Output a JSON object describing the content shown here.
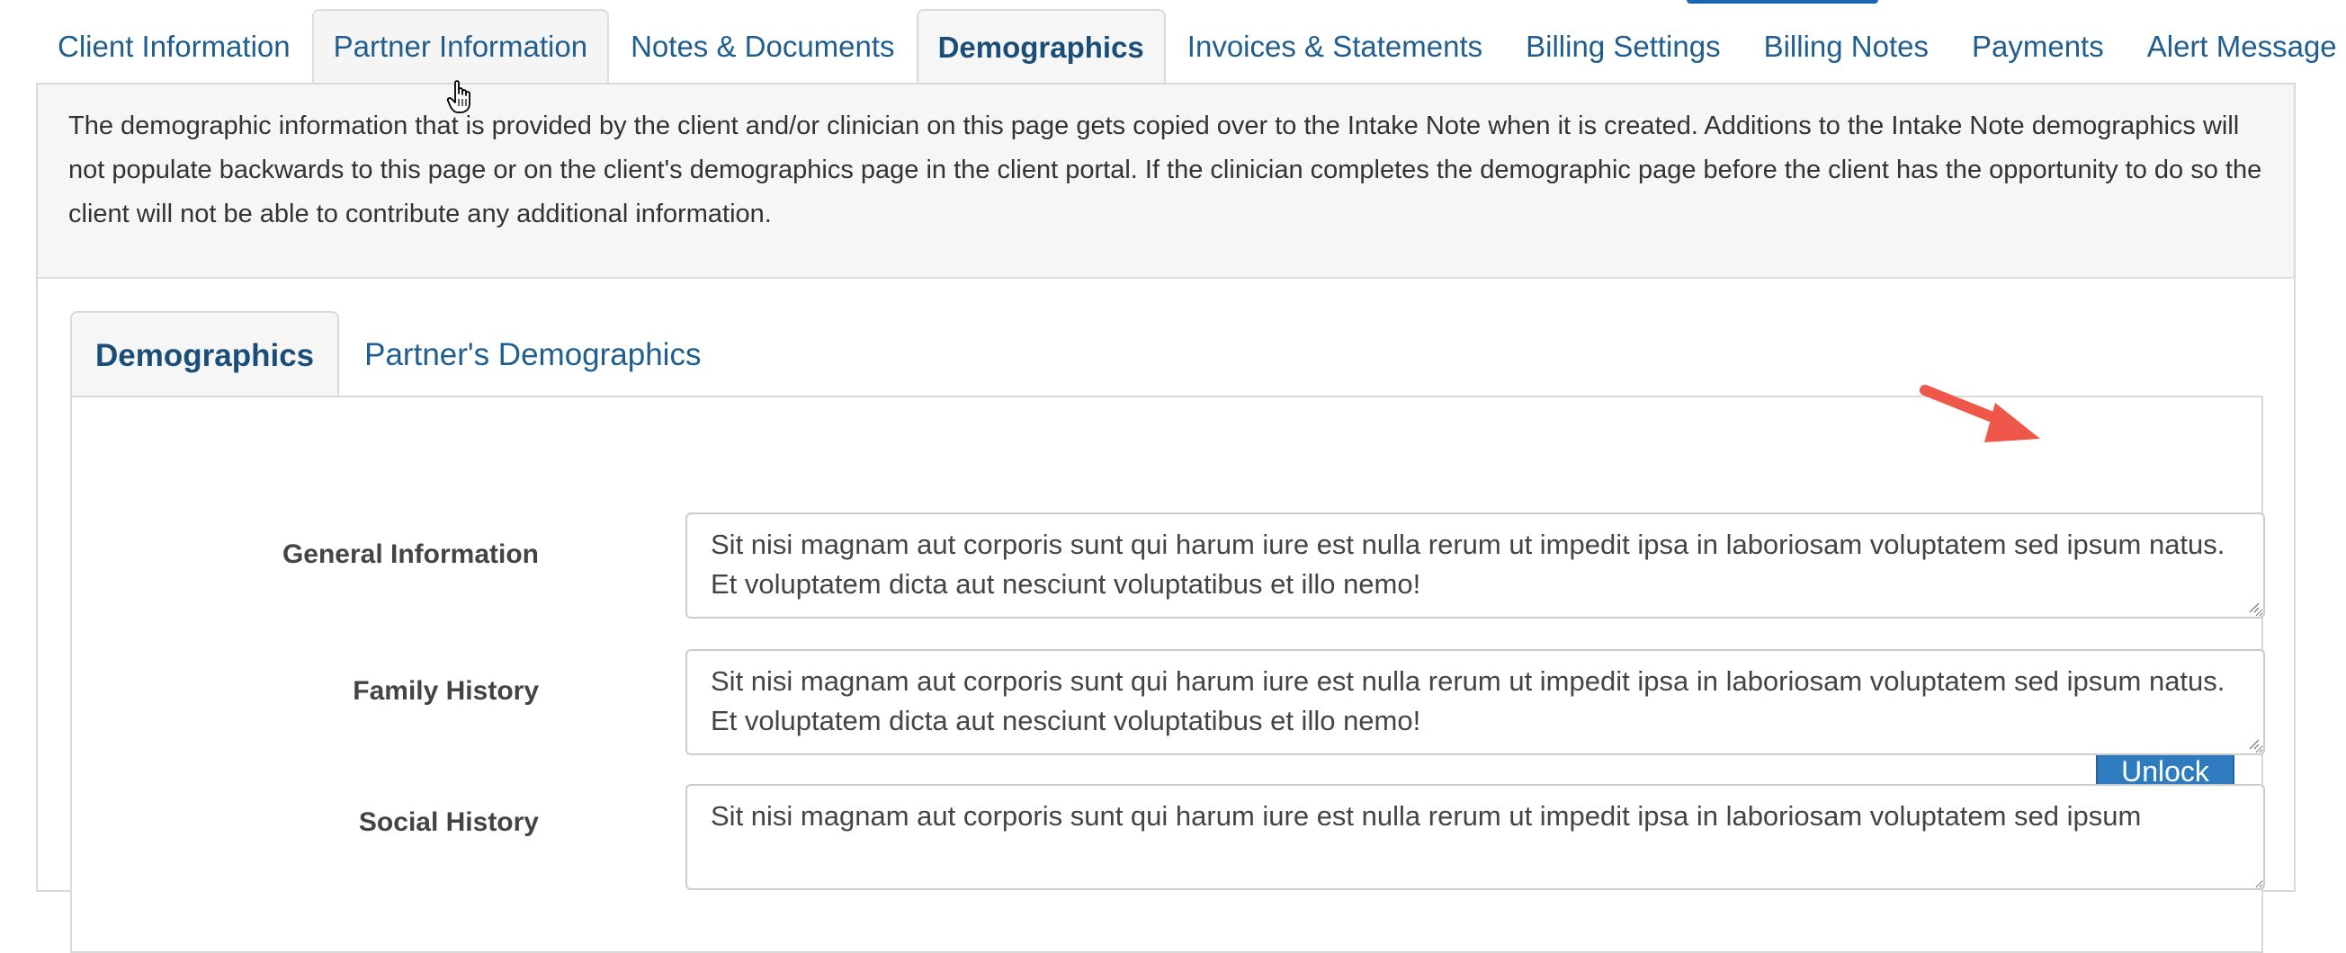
{
  "main_tabs": [
    {
      "label": "Client Information"
    },
    {
      "label": "Partner Information"
    },
    {
      "label": "Notes & Documents"
    },
    {
      "label": "Demographics"
    },
    {
      "label": "Invoices & Statements"
    },
    {
      "label": "Billing Settings"
    },
    {
      "label": "Billing Notes"
    },
    {
      "label": "Payments"
    },
    {
      "label": "Alert Message"
    }
  ],
  "info_text": "The demographic information that is provided by the client and/or clinician on this page gets copied over to the Intake Note when it is created. Additions to the Intake Note demographics will not populate backwards to this page or on the client's demographics page in the client portal. If the clinician completes the demographic page before the client has the opportunity to do so the client will not be able to contribute any additional information.",
  "sub_tabs": [
    {
      "label": "Demographics"
    },
    {
      "label": "Partner's Demographics"
    }
  ],
  "unlock_label": "Unlock",
  "fields": [
    {
      "label": "General Information",
      "value": "Sit nisi magnam aut corporis sunt qui harum iure est nulla rerum ut impedit ipsa in laboriosam voluptatem sed ipsum natus. Et voluptatem dicta aut nesciunt voluptatibus et illo nemo!"
    },
    {
      "label": "Family History",
      "value": "Sit nisi magnam aut corporis sunt qui harum iure est nulla rerum ut impedit ipsa in laboriosam voluptatem sed ipsum natus. Et voluptatem dicta aut nesciunt voluptatibus et illo nemo!"
    },
    {
      "label": "Social History",
      "value": "Sit nisi magnam aut corporis sunt qui harum iure est nulla rerum ut impedit ipsa in laboriosam voluptatem sed ipsum"
    }
  ],
  "colors": {
    "link": "#1f5e8f",
    "button": "#2f7bbf",
    "arrow": "#f0574b"
  }
}
